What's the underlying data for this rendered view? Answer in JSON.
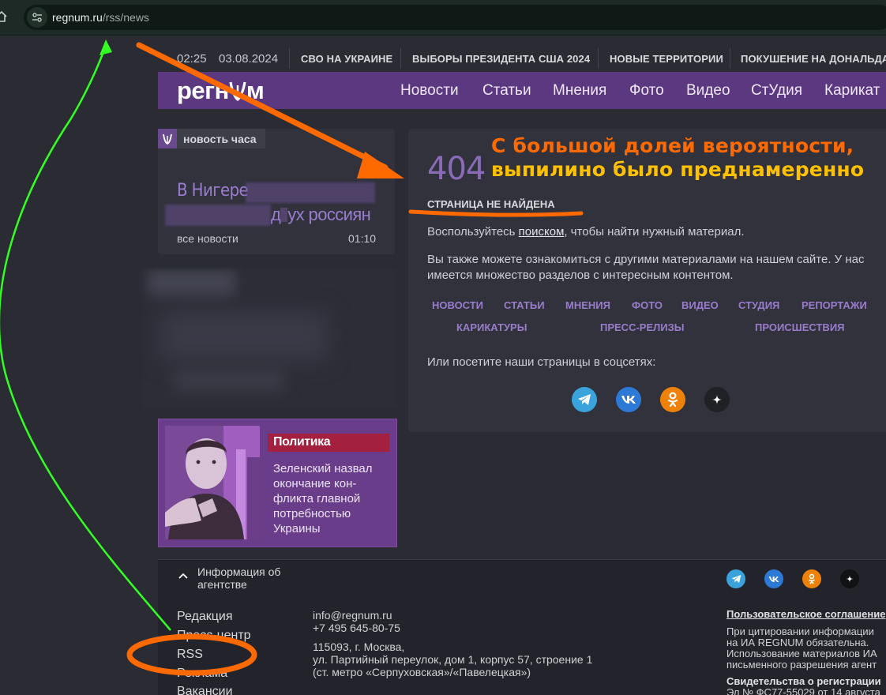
{
  "browser": {
    "url_host": "regnum.ru",
    "url_path": "/rss/news"
  },
  "topbar": {
    "time": "02:25",
    "date": "03.08.2024",
    "links": [
      "СВО НА УКРАИНЕ",
      "ВЫБОРЫ ПРЕЗИДЕНТА США 2024",
      "НОВЫЕ ТЕРРИТОРИИ",
      "ПОКУШЕНИЕ НА ДОНАЛЬДА"
    ]
  },
  "header": {
    "logo_left": "регн",
    "logo_right": "м",
    "nav": [
      "Новости",
      "Статьи",
      "Мнения",
      "Фото",
      "Видео",
      "СтУдия",
      "Карикат"
    ]
  },
  "hour_news": {
    "label": "новость часа",
    "title_start": "В Нигере",
    "title_end_a": "д",
    "title_end_b": "ух россиян",
    "all_news": "все новости",
    "time": "01:10"
  },
  "politics": {
    "tag": "Политика",
    "text": "Зеленский назвал окончание кон-фликта главной потребностью Украины"
  },
  "error": {
    "code": "404",
    "subtitle": "СТРАНИЦА НЕ НАЙДЕНА",
    "p1_before": "Воспользуйтесь ",
    "p1_link": "поиском",
    "p1_after": ", чтобы найти нужный материал.",
    "p2": "Вы также можете ознакомиться с другими материалами на нашем сайте. У нас имеется множество разделов с интересным контентом.",
    "sections": [
      "НОВОСТИ",
      "СТАТЬИ",
      "МНЕНИЯ",
      "ФОТО",
      "ВИДЕО",
      "СТУДИЯ",
      "РЕПОРТАЖИ",
      "КАРИКАТУРЫ",
      "ПРЕСС-РЕЛИЗЫ",
      "ПРОИСШЕСТВИЯ"
    ],
    "social_text": "Или посетите наши страницы в соцсетях:",
    "social_icons": [
      "telegram-icon",
      "vk-icon",
      "odnoklassniki-icon",
      "dzen-icon"
    ]
  },
  "footer": {
    "info_toggle": "Информация об агентстве",
    "menu": [
      "Редакция",
      "Пресс-центр",
      "RSS",
      "Реклама",
      "Вакансии"
    ],
    "email": "info@regnum.ru",
    "phone": "+7 495 645-80-75",
    "address1": "115093, г. Москва,",
    "address2": "ул. Партийный переулок, дом 1, корпус 57, строение 1",
    "address3": "(ст. метро «Серпуховская»/«Павелецкая»)",
    "agreement": "Пользовательское соглашение",
    "cite1": "При цитировании информации",
    "cite2": "на ИА REGNUM обязательна.",
    "cite3": "Использование материалов ИА",
    "cite4": "письменного разрешения агент",
    "reg_title": "Свидетельства о регистрации",
    "reg_line": "Эл № ФС77-55029 от 14 августа"
  },
  "annotation": {
    "line1": "С большой долей вероятности,",
    "line2": "выпилино было преднамеренно"
  },
  "colors": {
    "header_purple": "#5c3880",
    "accent_violet": "#9a7ccc",
    "annotation_orange": "#ff6a00",
    "annotation_yellow": "#ffc000",
    "annotation_green": "#33ff22"
  }
}
